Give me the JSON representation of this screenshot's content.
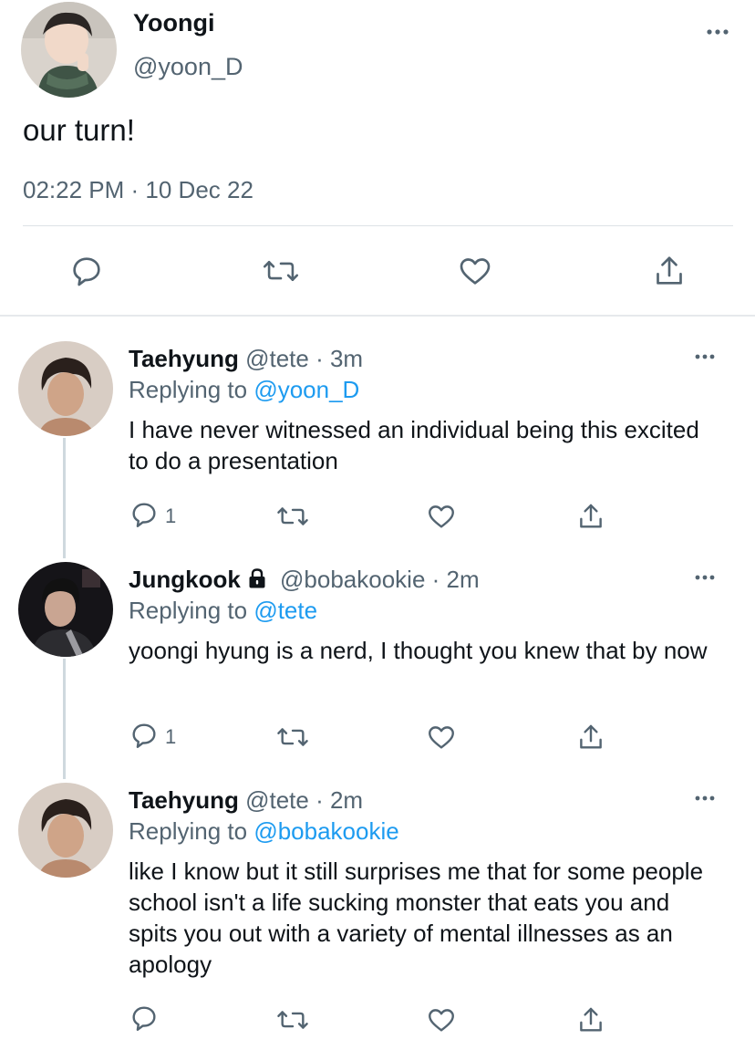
{
  "main_tweet": {
    "name": "Yoongi",
    "handle": "@yoon_D",
    "text": "our turn!",
    "timestamp": "02:22 PM · 10 Dec 22",
    "more_icon": "more-horizontal-icon",
    "actions": [
      "reply-icon",
      "retweet-icon",
      "like-icon",
      "share-icon"
    ]
  },
  "replies": [
    {
      "name": "Taehyung",
      "meta": " @tete · 3m",
      "replying_prefix": "Replying to ",
      "replying_to": "@yoon_D",
      "text": "I have never witnessed an individual being this excited to do a presentation",
      "reply_count": "1",
      "locked": false
    },
    {
      "name": "Jungkook",
      "meta": " @bobakookie · 2m",
      "replying_prefix": "Replying to ",
      "replying_to": "@tete",
      "text": "yoongi hyung is a nerd, I thought you knew that by now",
      "reply_count": "1",
      "locked": true
    },
    {
      "name": "Taehyung",
      "meta": " @tete · 2m",
      "replying_prefix": "Replying to ",
      "replying_to": "@bobakookie",
      "text": "like I know but it still surprises me that for some people school isn't a life sucking monster that eats you and spits you out with a variety of mental illnesses as an apology",
      "reply_count": "",
      "locked": false
    }
  ],
  "colors": {
    "accent": "#1d9bf0",
    "text": "#0f1419",
    "secondary": "#536471",
    "divider": "#dde2e6"
  }
}
